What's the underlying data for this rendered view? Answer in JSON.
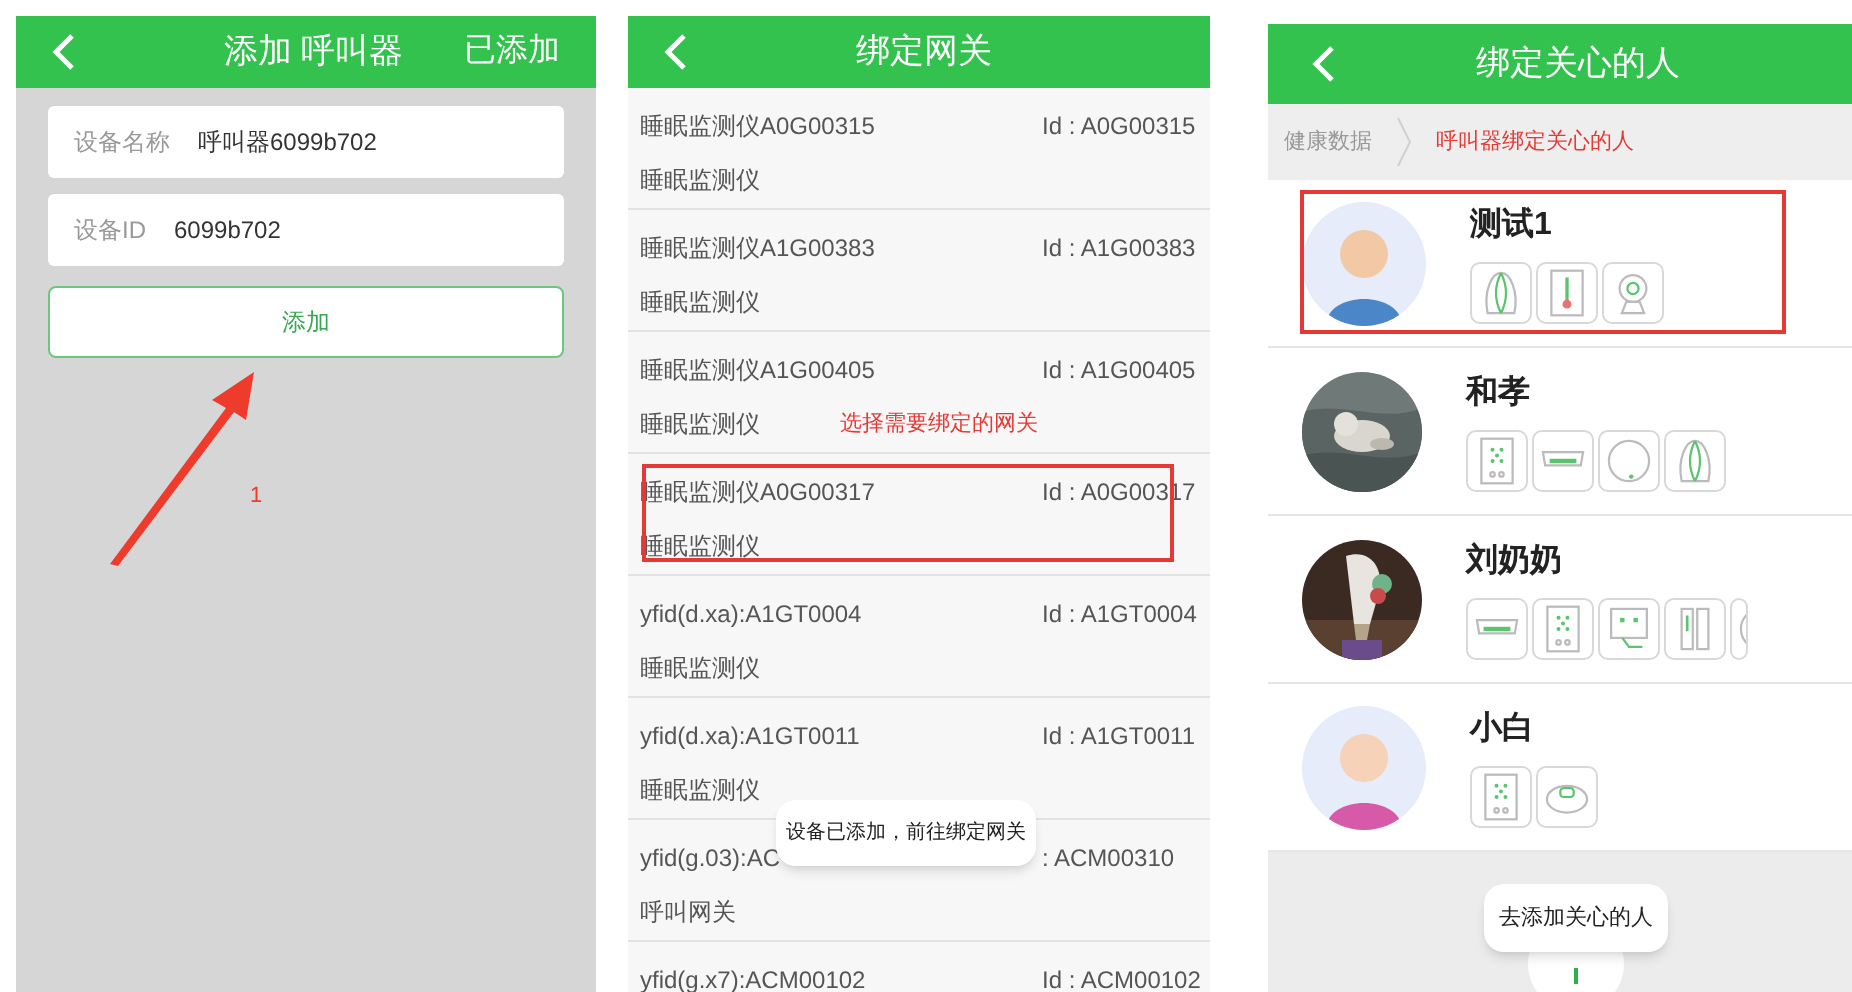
{
  "add_device_screen": {
    "title": "添加 呼叫器",
    "action": "已添加",
    "fields": [
      {
        "label": "设备名称",
        "value": "呼叫器6099b702"
      },
      {
        "label": "设备ID",
        "value": "6099b702"
      }
    ],
    "button": "添加",
    "annotation_label": "1"
  },
  "bind_gateway_screen": {
    "title": "绑定网关",
    "rows": [
      {
        "name": "睡眠监测仪A0G00315",
        "id": "Id : A0G00315",
        "type": "睡眠监测仪",
        "highlighted": false
      },
      {
        "name": "睡眠监测仪A1G00383",
        "id": "Id : A1G00383",
        "type": "睡眠监测仪",
        "highlighted": false
      },
      {
        "name": "睡眠监测仪A1G00405",
        "id": "Id : A1G00405",
        "type": "睡眠监测仪",
        "highlighted": false
      },
      {
        "name": "睡眠监测仪A0G00317",
        "id": "Id : A0G00317",
        "type": "睡眠监测仪",
        "highlighted": true
      },
      {
        "name": "yfid(d.xa):A1GT0004",
        "id": "Id : A1GT0004",
        "type": "睡眠监测仪",
        "highlighted": false
      },
      {
        "name": "yfid(d.xa):A1GT0011",
        "id": "Id : A1GT0011",
        "type": "睡眠监测仪",
        "highlighted": false
      },
      {
        "name": "yfid(g.03):AC",
        "id": ": ACM00310",
        "type": "呼叫网关",
        "highlighted": false
      },
      {
        "name": "yfid(g.x7):ACM00102",
        "id": "Id : ACM00102",
        "highlighted": false
      }
    ],
    "annotation_note": "选择需要绑定的网关",
    "toast": "设备已添加，前往绑定网关"
  },
  "bind_caregiver_screen": {
    "title": "绑定关心的人",
    "breadcrumb": [
      {
        "label": "健康数据",
        "selected": false
      },
      {
        "label": "呼叫器绑定关心的人",
        "selected": true
      }
    ],
    "people": [
      {
        "name": "测试1",
        "kind": "avatar",
        "highlighted": true,
        "devices": [
          {
            "kind": "shell"
          },
          {
            "kind": "thermometer"
          },
          {
            "kind": "camera"
          }
        ]
      },
      {
        "name": "和孝",
        "kind": "picture",
        "highlighted": false,
        "devices": [
          {
            "kind": "keypad"
          },
          {
            "kind": "bar"
          },
          {
            "kind": "ring"
          },
          {
            "kind": "shell"
          }
        ]
      },
      {
        "name": "刘奶奶",
        "kind": "picture",
        "highlighted": false,
        "devices": [
          {
            "kind": "bar"
          },
          {
            "kind": "keypad"
          },
          {
            "kind": "panel"
          },
          {
            "kind": "switch"
          },
          {
            "kind": "ring"
          }
        ]
      },
      {
        "name": "小白",
        "kind": "avatar",
        "highlighted": false,
        "devices": [
          {
            "kind": "keypad"
          },
          {
            "kind": "puck"
          }
        ]
      }
    ],
    "toast": "去添加关心的人"
  }
}
